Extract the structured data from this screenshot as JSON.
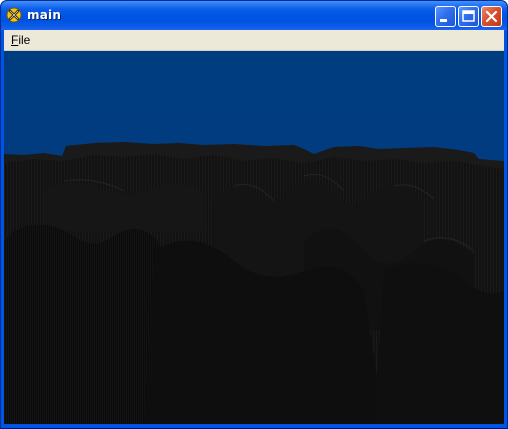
{
  "window": {
    "title": "main",
    "controls": {
      "minimize_icon": "minimize-icon",
      "maximize_icon": "maximize-icon",
      "close_icon": "close-icon"
    }
  },
  "menu": {
    "items": [
      {
        "label": "File",
        "accelerator": "F"
      }
    ]
  },
  "scene": {
    "sky_color": "#003b7e",
    "terrain_color": "#141414",
    "description_icon": "terrain-3d-view"
  }
}
